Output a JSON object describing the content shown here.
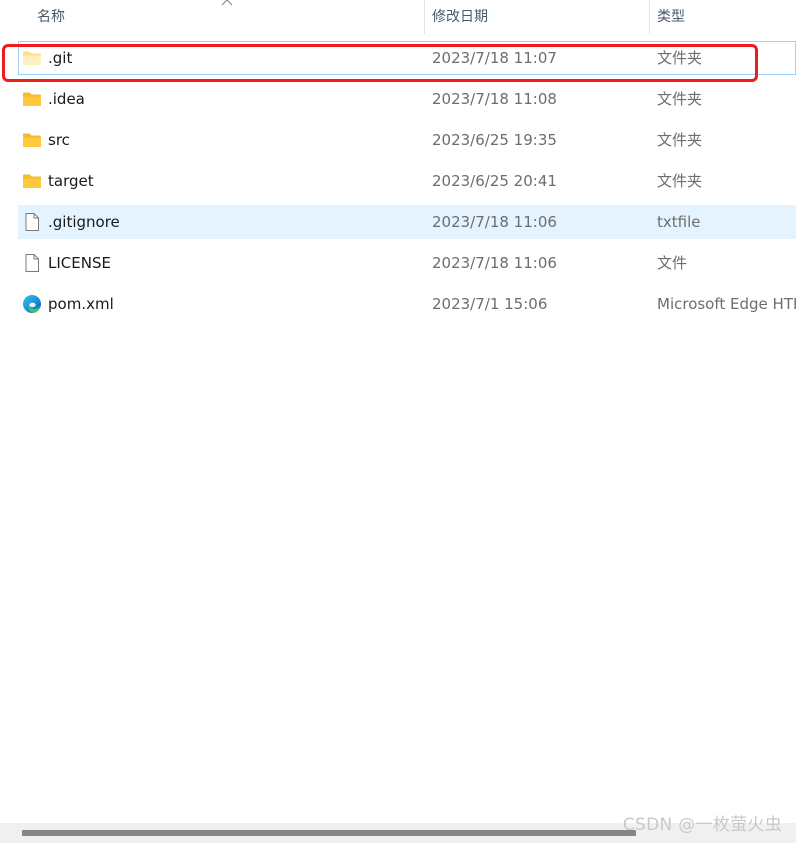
{
  "columns": {
    "name": "名称",
    "date": "修改日期",
    "type": "类型"
  },
  "files": [
    {
      "name": ".git",
      "date": "2023/7/18 11:07",
      "type": "文件夹",
      "icon": "folder-icon"
    },
    {
      "name": ".idea",
      "date": "2023/7/18 11:08",
      "type": "文件夹",
      "icon": "folder-icon"
    },
    {
      "name": "src",
      "date": "2023/6/25 19:35",
      "type": "文件夹",
      "icon": "folder-icon"
    },
    {
      "name": "target",
      "date": "2023/6/25 20:41",
      "type": "文件夹",
      "icon": "folder-icon"
    },
    {
      "name": ".gitignore",
      "date": "2023/7/18 11:06",
      "type": "txtfile",
      "icon": "file-icon"
    },
    {
      "name": "LICENSE",
      "date": "2023/7/18 11:06",
      "type": "文件",
      "icon": "file-icon"
    },
    {
      "name": "pom.xml",
      "date": "2023/7/1 15:06",
      "type": "Microsoft Edge HTML Document",
      "icon": "edge-icon"
    }
  ],
  "watermark": "CSDN @一枚萤火虫",
  "colors": {
    "annotation": "#ee1c1c",
    "hover_row": "#e5f3ff",
    "focus_border": "#99d1ff",
    "folder": "#ffc83d"
  }
}
